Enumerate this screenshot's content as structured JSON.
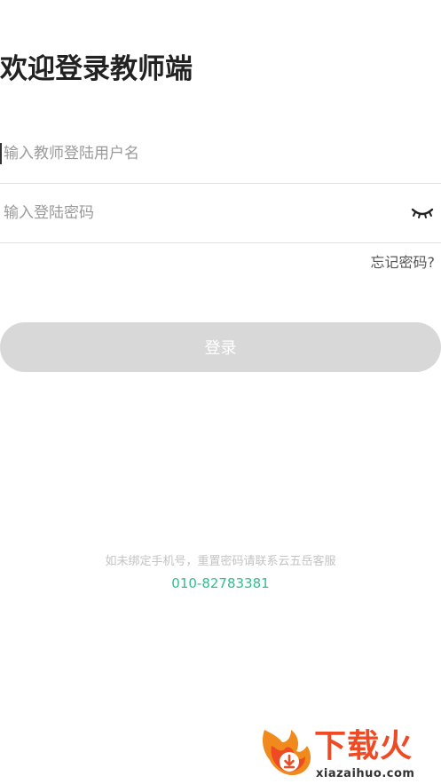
{
  "header": {
    "title": "欢迎登录教师端"
  },
  "form": {
    "username_placeholder": "输入教师登陆用户名",
    "username_value": "",
    "password_placeholder": "输入登陆密码",
    "password_value": "",
    "password_toggle_icon": "eye-closed-icon",
    "forgot_label": "忘记密码?",
    "login_label": "登录"
  },
  "footer": {
    "hint": "如未绑定手机号，重置密码请联系云五岳客服",
    "phone": "010-82783381"
  },
  "watermark": {
    "brand": "下载火",
    "domain": "xiazaihuo.com"
  },
  "colors": {
    "button_disabled": "#d8d8d8",
    "phone_accent": "#2fbf8e",
    "watermark_red": "#ee4a24"
  }
}
